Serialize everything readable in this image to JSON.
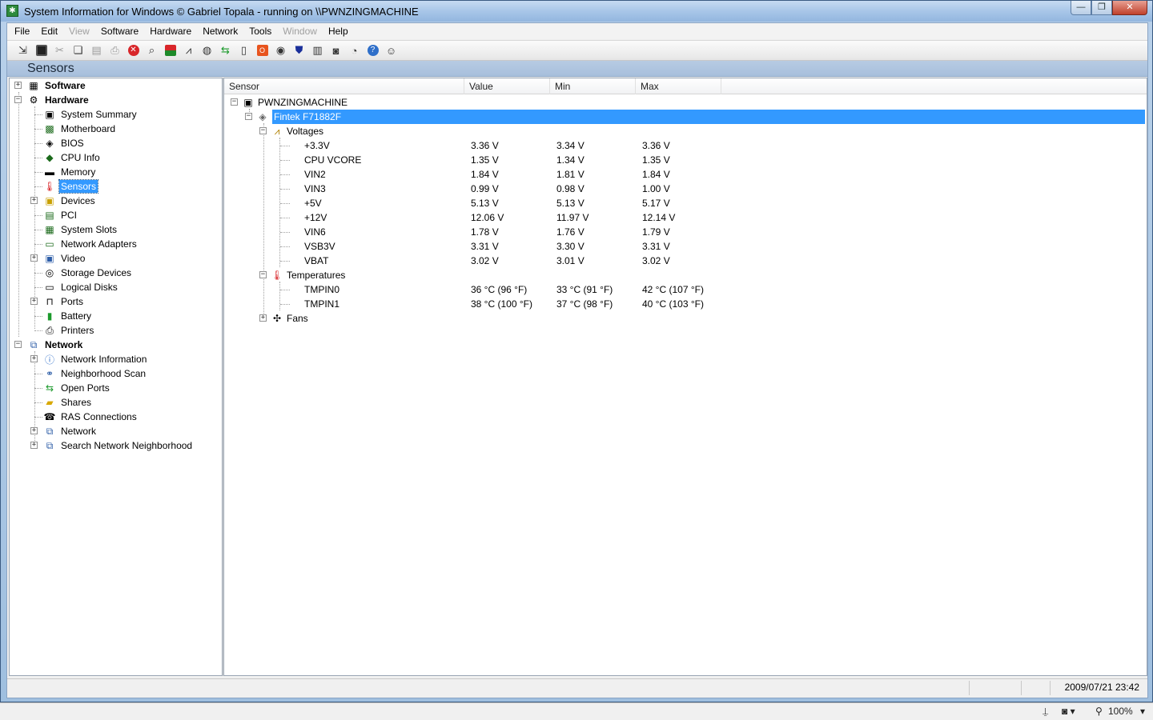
{
  "window": {
    "title": "System Information for Windows  © Gabriel Topala - running on \\\\PWNZINGMACHINE",
    "buttons": {
      "minimize": "—",
      "maximize": "❐",
      "close": "✕"
    }
  },
  "menu": [
    "File",
    "Edit",
    "View",
    "Software",
    "Hardware",
    "Network",
    "Tools",
    "Window",
    "Help"
  ],
  "menu_disabled": [
    "View",
    "Window"
  ],
  "section_title": "Sensors",
  "tree": {
    "software": "Software",
    "hardware": "Hardware",
    "hardware_children": [
      "System Summary",
      "Motherboard",
      "BIOS",
      "CPU Info",
      "Memory",
      "Sensors",
      "Devices",
      "PCI",
      "System Slots",
      "Network Adapters",
      "Video",
      "Storage Devices",
      "Logical Disks",
      "Ports",
      "Battery",
      "Printers"
    ],
    "network": "Network",
    "network_children": [
      "Network Information",
      "Neighborhood Scan",
      "Open Ports",
      "Shares",
      "RAS Connections",
      "Network",
      "Search Network Neighborhood"
    ],
    "selected": "Sensors"
  },
  "columns": {
    "sensor": "Sensor",
    "value": "Value",
    "min": "Min",
    "max": "Max"
  },
  "machine": "PWNZINGMACHINE",
  "chip": "Fintek F71882F",
  "voltages_label": "Voltages",
  "voltages": [
    {
      "name": "+3.3V",
      "value": "3.36 V",
      "min": "3.34 V",
      "max": "3.36 V"
    },
    {
      "name": "CPU VCORE",
      "value": "1.35 V",
      "min": "1.34 V",
      "max": "1.35 V"
    },
    {
      "name": "VIN2",
      "value": "1.84 V",
      "min": "1.81 V",
      "max": "1.84 V"
    },
    {
      "name": "VIN3",
      "value": "0.99 V",
      "min": "0.98 V",
      "max": "1.00 V"
    },
    {
      "name": "+5V",
      "value": "5.13 V",
      "min": "5.13 V",
      "max": "5.17 V"
    },
    {
      "name": "+12V",
      "value": "12.06 V",
      "min": "11.97 V",
      "max": "12.14 V"
    },
    {
      "name": "VIN6",
      "value": "1.78 V",
      "min": "1.76 V",
      "max": "1.79 V"
    },
    {
      "name": "VSB3V",
      "value": "3.31 V",
      "min": "3.30 V",
      "max": "3.31 V"
    },
    {
      "name": "VBAT",
      "value": "3.02 V",
      "min": "3.01 V",
      "max": "3.02 V"
    }
  ],
  "temperatures_label": "Temperatures",
  "temperatures": [
    {
      "name": "TMPIN0",
      "value": "36 °C  (96 °F)",
      "min": "33 °C  (91 °F)",
      "max": "42 °C  (107 °F)"
    },
    {
      "name": "TMPIN1",
      "value": "38 °C  (100 °F)",
      "min": "37 °C  (98 °F)",
      "max": "40 °C  (103 °F)"
    }
  ],
  "fans_label": "Fans",
  "status": {
    "datetime": "2009/07/21 23:42"
  },
  "outer_bar": {
    "zoom": "100%"
  },
  "colors": {
    "selection": "#3399ff",
    "title_bar": "#a8c6e8",
    "section_header": "#b7cbe3"
  }
}
